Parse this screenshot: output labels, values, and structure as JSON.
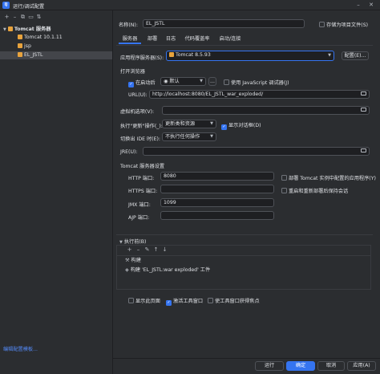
{
  "window": {
    "title": "运行/调试配置",
    "app_icon": "IJ"
  },
  "toolbar": {
    "icons": [
      "add-icon",
      "remove-icon",
      "copy-icon",
      "folder-icon",
      "sort-icon"
    ]
  },
  "tree": {
    "group_label": "Tomcat 服务器",
    "items": [
      "Tomcat 10.1.11",
      "jsp",
      "EL_JSTL"
    ],
    "selected": "EL_JSTL"
  },
  "edit_templates_link": "编辑配置模板...",
  "name_label": "名称(N):",
  "name_value": "EL_JSTL",
  "store_as_file_label": "存储为项目文件(S)",
  "tabs": [
    "服务器",
    "部署",
    "日志",
    "代码覆盖率",
    "启动/连接"
  ],
  "active_tab": "服务器",
  "app_server_label": "应用程序服务器(S):",
  "app_server_value": "Tomcat 8.5.93",
  "configure_button": "配置(E)...",
  "open_browser_section": "打开浏览器",
  "after_launch_label": "在启动后",
  "browser_value": "默认",
  "browse_more": "...",
  "use_js_debugger_label": "使用 JavaScript 调试器(J)",
  "url_label": "URL(U):",
  "url_value": "http://localhost:8080/EL_JSTL_war_exploded/",
  "vm_options_label": "虚拟机选项(V):",
  "vm_options_value": "",
  "on_update_label": "执行\"更新\"操作(_):",
  "on_update_value": "更新类和资源",
  "show_dialog_label": "显示对话框(D)",
  "on_frame_deactivation_label": "切换出 IDE 时(E):",
  "on_frame_deactivation_value": "不执行任何操作",
  "jre_label": "JRE(U):",
  "jre_value": "",
  "tomcat_settings_section": "Tomcat 服务器设置",
  "http_port_label": "HTTP 端口:",
  "http_port_value": "8080",
  "https_port_label": "HTTPS 端口:",
  "https_port_value": "",
  "jmx_port_label": "JMX 端口:",
  "jmx_port_value": "1099",
  "ajp_port_label": "AJP 端口:",
  "ajp_port_value": "",
  "deploy_configured_label": "部署 Tomcat 实例中配置的应用程序(Y)",
  "preserve_sessions_label": "重启和重新部署后保持会话",
  "before_launch_section": "执行前(B)",
  "task_toolbar_icons": [
    "add-icon",
    "remove-icon",
    "edit-icon",
    "up-icon",
    "down-icon"
  ],
  "tasks": [
    "构建",
    "构建 'EL_JSTL:war exploded' 工件"
  ],
  "show_this_page_label": "显示此页面",
  "activate_tool_window_label": "激活工具窗口",
  "focus_tool_window_label": "使工具窗口获得焦点",
  "run_button": "运行",
  "ok_button": "确定",
  "cancel_button": "取消",
  "apply_button": "应用(A)",
  "colors": {
    "accent": "#3574f0",
    "background": "#2b2d30",
    "field": "#1e1f22",
    "link": "#548af7"
  }
}
